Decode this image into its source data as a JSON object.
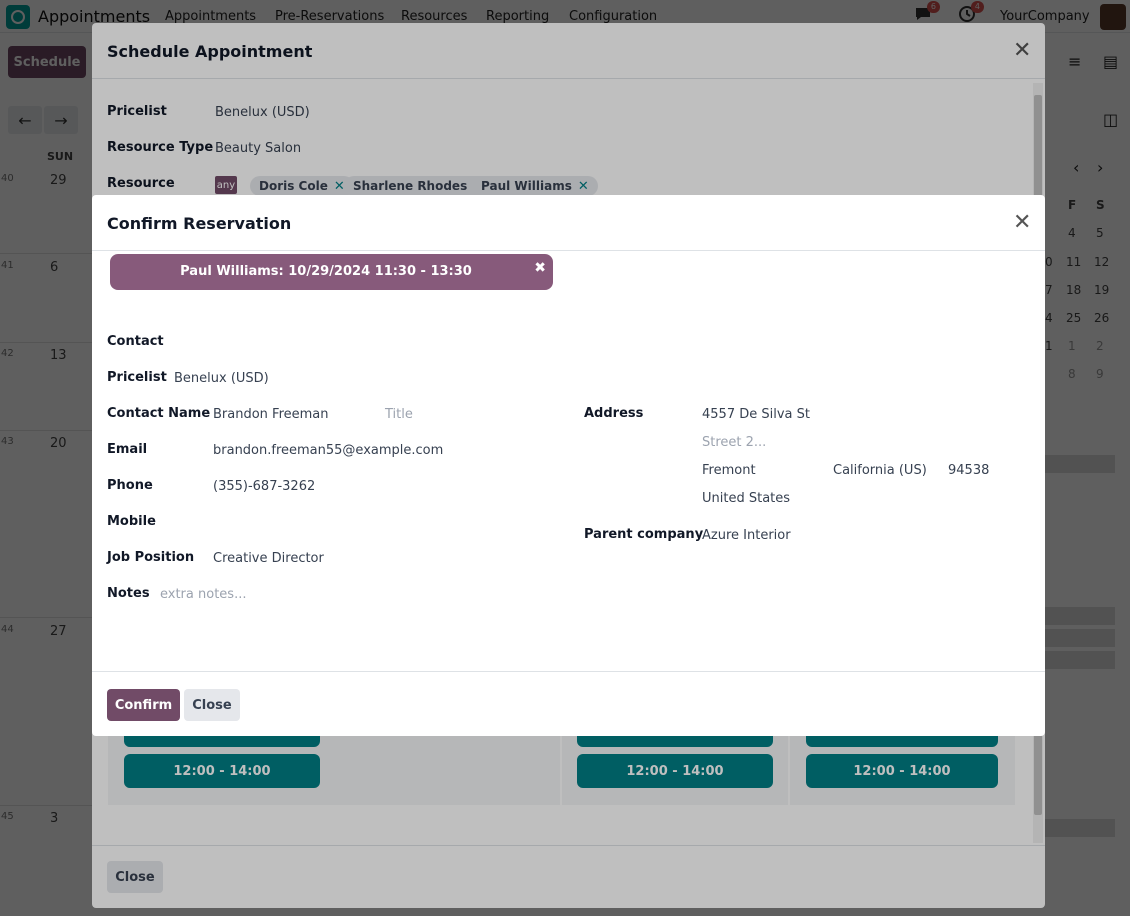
{
  "topnav": {
    "app_title": "Appointments",
    "menu": [
      "Appointments",
      "Pre-Reservations",
      "Resources",
      "Reporting",
      "Configuration"
    ],
    "chat_count": "6",
    "activity_count": "4",
    "company": "YourCompany"
  },
  "toolbar": {
    "schedule_label": "Schedule"
  },
  "calendar": {
    "day_header": "SUN",
    "weeks": [
      {
        "num": "40",
        "day": "29"
      },
      {
        "num": "41",
        "day": "6"
      },
      {
        "num": "42",
        "day": "13"
      },
      {
        "num": "43",
        "day": "20"
      },
      {
        "num": "44",
        "day": "27"
      },
      {
        "num": "45",
        "day": "3"
      }
    ],
    "mini_headers": [
      "F",
      "S"
    ],
    "mini_rows": [
      [
        "4",
        "5"
      ],
      [
        "11",
        "12"
      ],
      [
        "18",
        "19"
      ],
      [
        "25",
        "26"
      ],
      [
        "1",
        "2"
      ],
      [
        "8",
        "9"
      ]
    ],
    "mini_partial": [
      "0",
      "7",
      "4",
      "1"
    ]
  },
  "schedule_modal": {
    "title": "Schedule Appointment",
    "pricelist_label": "Pricelist",
    "pricelist_value": "Benelux (USD)",
    "resource_type_label": "Resource Type",
    "resource_type_value": "Beauty Salon",
    "resource_label": "Resource",
    "any_label": "any",
    "resources": [
      "Doris Cole",
      "Sharlene Rhodes",
      "Paul Williams"
    ],
    "slot_label": "12:00 - 14:00",
    "close_label": "Close"
  },
  "confirm_modal": {
    "title": "Confirm Reservation",
    "reservation": "Paul Williams: 10/29/2024 11:30 - 13:30",
    "contact_label": "Contact",
    "pricelist_label": "Pricelist",
    "pricelist_value": "Benelux (USD)",
    "contact_name_label": "Contact Name",
    "contact_name_value": "Brandon Freeman",
    "title_placeholder": "Title",
    "email_label": "Email",
    "email_value": "brandon.freeman55@example.com",
    "phone_label": "Phone",
    "phone_value": "(355)-687-3262",
    "mobile_label": "Mobile",
    "job_label": "Job Position",
    "job_value": "Creative Director",
    "notes_label": "Notes",
    "notes_placeholder": "extra notes...",
    "address_label": "Address",
    "street": "4557 De Silva St",
    "street2_placeholder": "Street 2...",
    "city": "Fremont",
    "state": "California (US)",
    "zip": "94538",
    "country": "United States",
    "parent_company_label": "Parent company",
    "parent_company_value": "Azure Interior",
    "confirm_label": "Confirm",
    "close_label": "Close"
  },
  "colors": {
    "brand": "#714b67",
    "reservation_pill": "#875a7b",
    "slot": "#017e84"
  }
}
